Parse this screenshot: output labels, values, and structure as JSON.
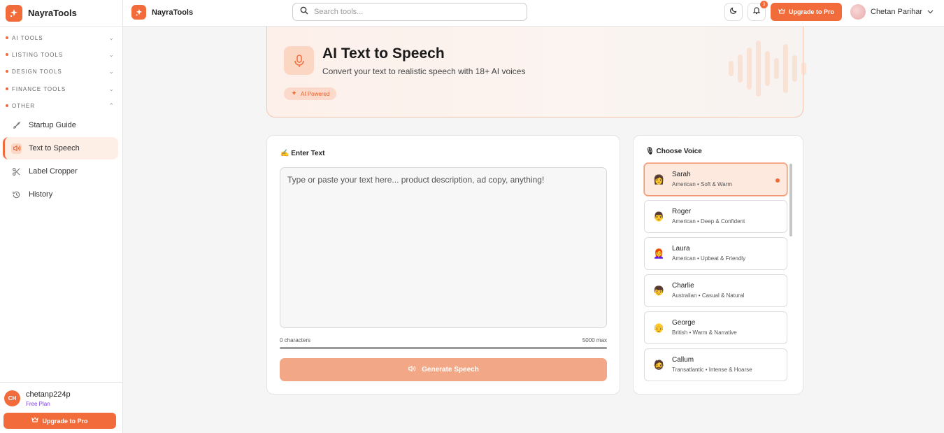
{
  "app": {
    "name": "NayraTools"
  },
  "sidebar": {
    "sections": [
      {
        "label": "AI TOOLS",
        "expanded": false
      },
      {
        "label": "LISTING TOOLS",
        "expanded": false
      },
      {
        "label": "DESIGN TOOLS",
        "expanded": false
      },
      {
        "label": "FINANCE TOOLS",
        "expanded": false
      },
      {
        "label": "OTHER",
        "expanded": true
      }
    ],
    "items": [
      {
        "label": "Startup Guide",
        "icon": "rocket-icon"
      },
      {
        "label": "Text to Speech",
        "icon": "speaker-icon",
        "active": true
      },
      {
        "label": "Label Cropper",
        "icon": "scissors-icon"
      },
      {
        "label": "History",
        "icon": "history-icon"
      }
    ],
    "user": {
      "initials": "CH",
      "name": "chetanp224p",
      "plan": "Free Plan"
    },
    "upgrade_label": "Upgrade to Pro"
  },
  "topbar": {
    "brand": "NayraTools",
    "search_placeholder": "Search tools...",
    "notifications": "3",
    "upgrade_label": "Upgrade to Pro",
    "user_name": "Chetan Parihar"
  },
  "hero": {
    "title": "AI Text to Speech",
    "subtitle": "Convert your text to realistic speech with 18+ AI voices",
    "badge": "AI Powered"
  },
  "editor": {
    "heading": "Enter Text",
    "heading_emoji": "✍️",
    "placeholder": "Type or paste your text here... product description, ad copy, anything!",
    "char_count": "0 characters",
    "max": "5000 max",
    "generate_label": "Generate Speech"
  },
  "voices": {
    "heading": "Choose Voice",
    "heading_emoji": "🎙",
    "list": [
      {
        "name": "Sarah",
        "desc": "American • Soft & Warm",
        "emoji": "👩",
        "selected": true
      },
      {
        "name": "Roger",
        "desc": "American • Deep & Confident",
        "emoji": "👨",
        "selected": false
      },
      {
        "name": "Laura",
        "desc": "American • Upbeat & Friendly",
        "emoji": "👩‍🦰",
        "selected": false
      },
      {
        "name": "Charlie",
        "desc": "Australian • Casual & Natural",
        "emoji": "👦",
        "selected": false
      },
      {
        "name": "George",
        "desc": "British • Warm & Narrative",
        "emoji": "👴",
        "selected": false
      },
      {
        "name": "Callum",
        "desc": "Transatlantic • Intense & Hoarse",
        "emoji": "🧔",
        "selected": false
      }
    ]
  },
  "colors": {
    "accent": "#f26b3a",
    "accent_light": "#fde9de"
  }
}
